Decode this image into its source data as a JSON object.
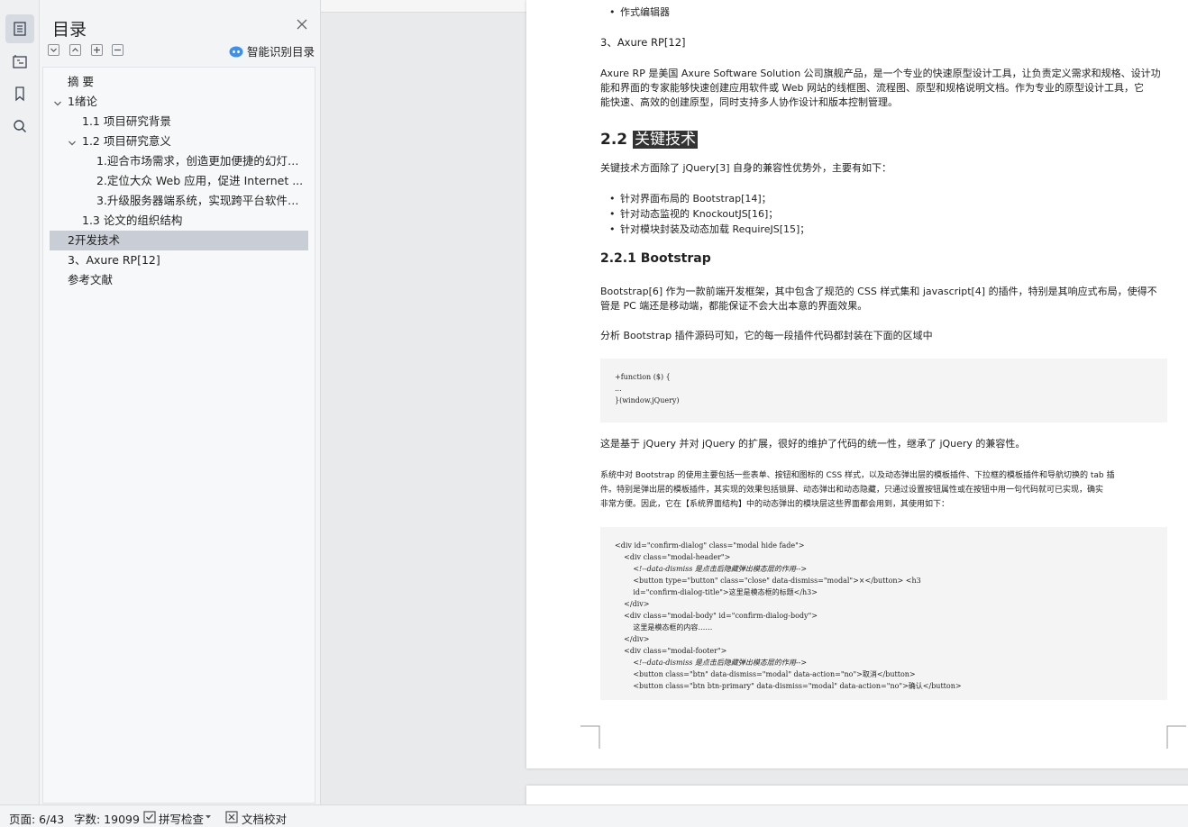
{
  "toc": {
    "title": "目录",
    "smart_label": "智能识别目录",
    "items": [
      {
        "label": "摘 要"
      },
      {
        "label": "1绪论"
      },
      {
        "label": "1.1 项目研究背景"
      },
      {
        "label": "1.2 项目研究意义"
      },
      {
        "label": "1.迎合市场需求，创造更加便捷的幻灯片 ..."
      },
      {
        "label": "2.定位大众 Web 应用，促进 Internet ..."
      },
      {
        "label": "3.升级服务器端系统，实现跨平台软件版 ..."
      },
      {
        "label": "1.3 论文的组织结构"
      },
      {
        "label": "2开发技术"
      },
      {
        "label": "3、Axure RP[12]"
      },
      {
        "label": "参考文献"
      }
    ]
  },
  "doc": {
    "top_bullet": "作式编辑器",
    "axure_heading": "3、Axure RP[12]",
    "axure_para_1": "Axure RP 是美国 Axure Software Solution 公司旗舰产品，是一个专业的快速原型设计工具，让负责定义需求和规格、设计功",
    "axure_para_2": "能和界面的专家能够快速创建应用软件或 Web 网站的线框图、流程图、原型和规格说明文档。作为专业的原型设计工具，它",
    "axure_para_3": "能快速、高效的创建原型，同时支持多人协作设计和版本控制管理。",
    "section_num": "2.2",
    "section_title": "关键技术",
    "key_intro": "关键技术方面除了 jQuery[3] 自身的兼容性优势外，主要有如下：",
    "bullets": [
      "针对界面布局的 Bootstrap[14]；",
      "针对动态监视的 KnockoutJS[16]；",
      "针对模块封装及动态加载 RequireJS[15]；"
    ],
    "subsection": "2.2.1 Bootstrap",
    "bs_para_1": "Bootstrap[6] 作为一款前端开发框架，其中包含了规范的 CSS 样式集和 javascript[4] 的插件，特别是其响应式布局，使得不",
    "bs_para_2": "管是 PC 端还是移动端，都能保证不会大出本意的界面效果。",
    "bs_para_3": "分析 Bootstrap 插件源码可知，它的每一段插件代码都封装在下面的区域中",
    "code1": [
      "+function ($) {",
      "...",
      "}(window.jQuery)"
    ],
    "ext_para": "这是基于 jQuery 并对 jQuery 的扩展，很好的维护了代码的统一性，继承了 jQuery 的兼容性。",
    "sys_para_1": "系统中对 Bootstrap 的使用主要包括一些表单、按钮和图标的 CSS 样式，以及动态弹出层的模板插件、下拉框的模板插件和导航切换的 tab 插",
    "sys_para_2": "件。特别是弹出层的模板插件，其实现的效果包括锁屏、动态弹出和动态隐藏，只通过设置按钮属性或在按钮中用一句代码就可已实现，确实",
    "sys_para_3": "非常方便。因此，它在【系统界面结构】中的动态弹出的模块层这些界面都会用到，其使用如下：",
    "code2": [
      "<div id=\"confirm-dialog\" class=\"modal hide fade\">",
      "    <div class=\"modal-header\">",
      "        <!--data-dismiss 是点击后隐藏弹出模态层的作用-->",
      "        <button type=\"button\" class=\"close\" data-dismiss=\"modal\">×</button> <h3",
      "        id=\"confirm-dialog-title\">这里是模态框的标题</h3>",
      "    </div>",
      "    <div class=\"modal-body\" id=\"confirm-dialog-body\">",
      "        这里是模态框的内容……",
      "    </div>",
      "    <div class=\"modal-footer\">",
      "        <!--data-dismiss 是点击后隐藏弹出模态层的作用-->",
      "        <button class=\"btn\" data-dismiss=\"modal\" data-action=\"no\">取消</button>",
      "        <button class=\"btn btn-primary\" data-dismiss=\"modal\" data-action=\"no\">确认</button>"
    ]
  },
  "status": {
    "page": "页面: 6/43",
    "words": "字数: 19099",
    "spell": "拼写检查",
    "proof": "文档校对"
  },
  "colors": {
    "selected_row": "#c9ced6",
    "heading_highlight": "#333333",
    "smart_icon": "#3b8ff0"
  }
}
